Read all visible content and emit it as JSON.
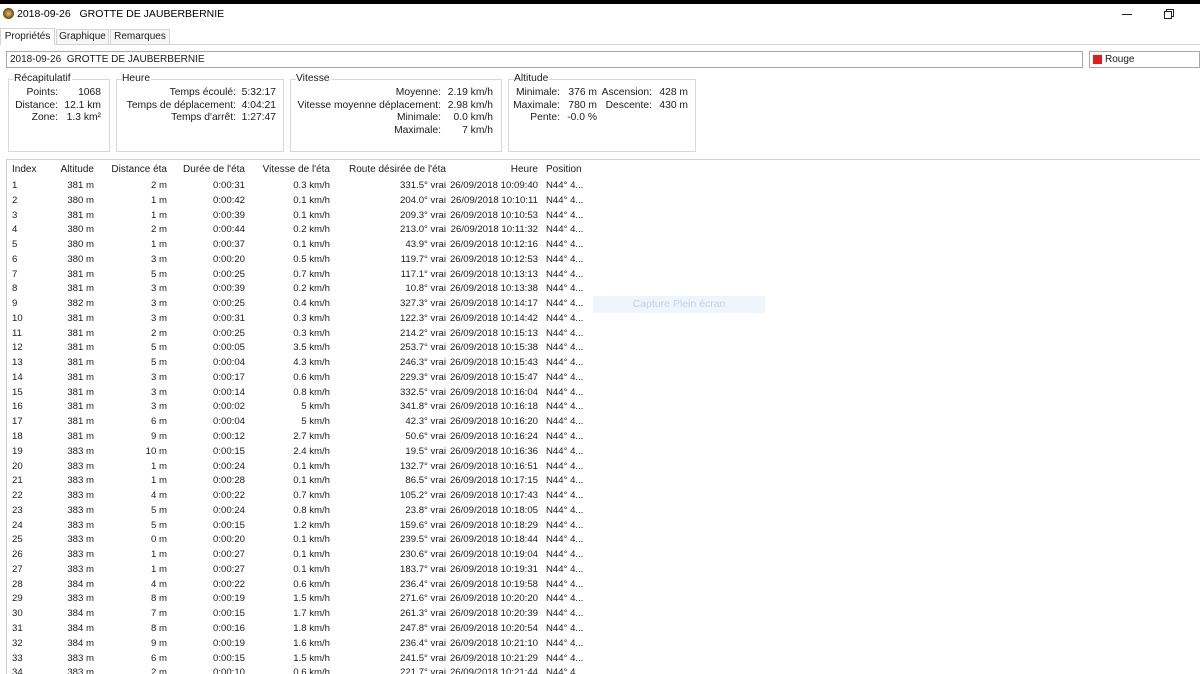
{
  "window": {
    "title": "2018-09-26   GROTTE DE JAUBERBERNIE",
    "icons": {
      "app": "app-icon",
      "minimize": "minimize-icon",
      "restore": "restore-icon"
    }
  },
  "tabs": [
    {
      "label": "Propriétés",
      "selected": true
    },
    {
      "label": "Graphique",
      "selected": false
    },
    {
      "label": "Remarques",
      "selected": false
    }
  ],
  "properties": {
    "name_value": "2018-09-26  GROTTE DE JAUBERBERNIE",
    "color": {
      "label": "Rouge",
      "swatch": "#e21c1c"
    }
  },
  "summary": {
    "title": "Récapitulatif",
    "rows": [
      {
        "label": "Points:",
        "value": "1068"
      },
      {
        "label": "Distance:",
        "value": "12.1 km"
      },
      {
        "label": "Zone:",
        "value": "1.3 km²"
      }
    ]
  },
  "time": {
    "title": "Heure",
    "rows": [
      {
        "label": "Temps écoulé:",
        "value": "5:32:17"
      },
      {
        "label": "Temps de déplacement:",
        "value": "4:04:21"
      },
      {
        "label": "Temps d'arrêt:",
        "value": "1:27:47"
      }
    ]
  },
  "speed": {
    "title": "Vitesse",
    "rows": [
      {
        "label": "Moyenne:",
        "value": "2.19 km/h"
      },
      {
        "label": "Vitesse moyenne déplacement:",
        "value": "2.98 km/h"
      },
      {
        "label": "Minimale:",
        "value": "0.0 km/h"
      },
      {
        "label": "Maximale:",
        "value": "7 km/h"
      }
    ]
  },
  "altitude": {
    "title": "Altitude",
    "minimum": {
      "label": "Minimale:",
      "value": "376 m"
    },
    "ascent": {
      "label": "Ascension:",
      "value": "428 m"
    },
    "maximum": {
      "label": "Maximale:",
      "value": "780 m"
    },
    "descent": {
      "label": "Descente:",
      "value": "430 m"
    },
    "slope": {
      "label": "Pente:",
      "value": "-0.0 %"
    }
  },
  "table": {
    "columns": [
      "Index",
      "Altitude",
      "Distance éta",
      "Durée de l'éta",
      "Vitesse de l'éta",
      "Route désirée de l'éta",
      "Heure",
      "Position"
    ],
    "rows": [
      [
        "1",
        "381 m",
        "2 m",
        "0:00:31",
        "0.3 km/h",
        "331.5° vrai",
        "26/09/2018 10:09:40",
        "N44° 4..."
      ],
      [
        "2",
        "380 m",
        "1 m",
        "0:00:42",
        "0.1 km/h",
        "204.0° vrai",
        "26/09/2018 10:10:11",
        "N44° 4..."
      ],
      [
        "3",
        "381 m",
        "1 m",
        "0:00:39",
        "0.1 km/h",
        "209.3° vrai",
        "26/09/2018 10:10:53",
        "N44° 4..."
      ],
      [
        "4",
        "380 m",
        "2 m",
        "0:00:44",
        "0.2 km/h",
        "213.0° vrai",
        "26/09/2018 10:11:32",
        "N44° 4..."
      ],
      [
        "5",
        "380 m",
        "1 m",
        "0:00:37",
        "0.1 km/h",
        "43.9° vrai",
        "26/09/2018 10:12:16",
        "N44° 4..."
      ],
      [
        "6",
        "380 m",
        "3 m",
        "0:00:20",
        "0.5 km/h",
        "119.7° vrai",
        "26/09/2018 10:12:53",
        "N44° 4..."
      ],
      [
        "7",
        "381 m",
        "5 m",
        "0:00:25",
        "0.7 km/h",
        "117.1° vrai",
        "26/09/2018 10:13:13",
        "N44° 4..."
      ],
      [
        "8",
        "381 m",
        "3 m",
        "0:00:39",
        "0.2 km/h",
        "10.8° vrai",
        "26/09/2018 10:13:38",
        "N44° 4..."
      ],
      [
        "9",
        "382 m",
        "3 m",
        "0:00:25",
        "0.4 km/h",
        "327.3° vrai",
        "26/09/2018 10:14:17",
        "N44° 4..."
      ],
      [
        "10",
        "381 m",
        "3 m",
        "0:00:31",
        "0.3 km/h",
        "122.3° vrai",
        "26/09/2018 10:14:42",
        "N44° 4..."
      ],
      [
        "11",
        "381 m",
        "2 m",
        "0:00:25",
        "0.3 km/h",
        "214.2° vrai",
        "26/09/2018 10:15:13",
        "N44° 4..."
      ],
      [
        "12",
        "381 m",
        "5 m",
        "0:00:05",
        "3.5 km/h",
        "253.7° vrai",
        "26/09/2018 10:15:38",
        "N44° 4..."
      ],
      [
        "13",
        "381 m",
        "5 m",
        "0:00:04",
        "4.3 km/h",
        "246.3° vrai",
        "26/09/2018 10:15:43",
        "N44° 4..."
      ],
      [
        "14",
        "381 m",
        "3 m",
        "0:00:17",
        "0.6 km/h",
        "229.3° vrai",
        "26/09/2018 10:15:47",
        "N44° 4..."
      ],
      [
        "15",
        "381 m",
        "3 m",
        "0:00:14",
        "0.8 km/h",
        "332.5° vrai",
        "26/09/2018 10:16:04",
        "N44° 4..."
      ],
      [
        "16",
        "381 m",
        "3 m",
        "0:00:02",
        "5 km/h",
        "341.8° vrai",
        "26/09/2018 10:16:18",
        "N44° 4..."
      ],
      [
        "17",
        "381 m",
        "6 m",
        "0:00:04",
        "5 km/h",
        "42.3° vrai",
        "26/09/2018 10:16:20",
        "N44° 4..."
      ],
      [
        "18",
        "381 m",
        "9 m",
        "0:00:12",
        "2.7 km/h",
        "50.6° vrai",
        "26/09/2018 10:16:24",
        "N44° 4..."
      ],
      [
        "19",
        "383 m",
        "10 m",
        "0:00:15",
        "2.4 km/h",
        "19.5° vrai",
        "26/09/2018 10:16:36",
        "N44° 4..."
      ],
      [
        "20",
        "383 m",
        "1 m",
        "0:00:24",
        "0.1 km/h",
        "132.7° vrai",
        "26/09/2018 10:16:51",
        "N44° 4..."
      ],
      [
        "21",
        "383 m",
        "1 m",
        "0:00:28",
        "0.1 km/h",
        "86.5° vrai",
        "26/09/2018 10:17:15",
        "N44° 4..."
      ],
      [
        "22",
        "383 m",
        "4 m",
        "0:00:22",
        "0.7 km/h",
        "105.2° vrai",
        "26/09/2018 10:17:43",
        "N44° 4..."
      ],
      [
        "23",
        "383 m",
        "5 m",
        "0:00:24",
        "0.8 km/h",
        "23.8° vrai",
        "26/09/2018 10:18:05",
        "N44° 4..."
      ],
      [
        "24",
        "383 m",
        "5 m",
        "0:00:15",
        "1.2 km/h",
        "159.6° vrai",
        "26/09/2018 10:18:29",
        "N44° 4..."
      ],
      [
        "25",
        "383 m",
        "0 m",
        "0:00:20",
        "0.1 km/h",
        "239.5° vrai",
        "26/09/2018 10:18:44",
        "N44° 4..."
      ],
      [
        "26",
        "383 m",
        "1 m",
        "0:00:27",
        "0.1 km/h",
        "230.6° vrai",
        "26/09/2018 10:19:04",
        "N44° 4..."
      ],
      [
        "27",
        "383 m",
        "1 m",
        "0:00:27",
        "0.1 km/h",
        "183.7° vrai",
        "26/09/2018 10:19:31",
        "N44° 4..."
      ],
      [
        "28",
        "384 m",
        "4 m",
        "0:00:22",
        "0.6 km/h",
        "236.4° vrai",
        "26/09/2018 10:19:58",
        "N44° 4..."
      ],
      [
        "29",
        "383 m",
        "8 m",
        "0:00:19",
        "1.5 km/h",
        "271.6° vrai",
        "26/09/2018 10:20:20",
        "N44° 4..."
      ],
      [
        "30",
        "384 m",
        "7 m",
        "0:00:15",
        "1.7 km/h",
        "261.3° vrai",
        "26/09/2018 10:20:39",
        "N44° 4..."
      ],
      [
        "31",
        "384 m",
        "8 m",
        "0:00:16",
        "1.8 km/h",
        "247.8° vrai",
        "26/09/2018 10:20:54",
        "N44° 4..."
      ],
      [
        "32",
        "384 m",
        "9 m",
        "0:00:19",
        "1.6 km/h",
        "236.4° vrai",
        "26/09/2018 10:21:10",
        "N44° 4..."
      ],
      [
        "33",
        "383 m",
        "6 m",
        "0:00:15",
        "1.5 km/h",
        "241.5° vrai",
        "26/09/2018 10:21:29",
        "N44° 4..."
      ],
      [
        "34",
        "383 m",
        "2 m",
        "0:00:10",
        "0.6 km/h",
        "221.7° vrai",
        "26/09/2018 10:21:44",
        "N44° 4..."
      ]
    ]
  },
  "overlay": {
    "text": "Capture Plein écran"
  }
}
